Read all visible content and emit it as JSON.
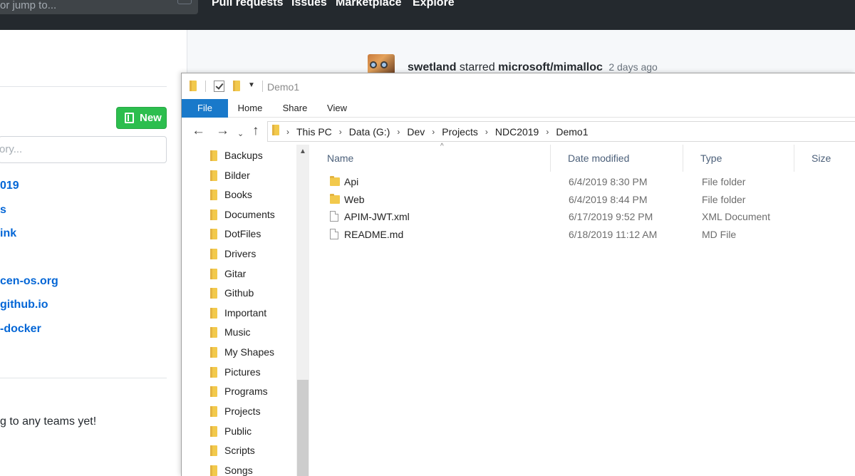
{
  "github": {
    "search_placeholder": "or jump to...",
    "search_shortcut": "/",
    "nav": [
      "Pull requests",
      "Issues",
      "Marketplace",
      "Explore"
    ],
    "new_button": "New",
    "filter_placeholder": "ory...",
    "repos": [
      "019",
      "s",
      "ink",
      "cen-os.org",
      "github.io",
      "-docker"
    ],
    "teams_text": "g to any teams yet!",
    "activity": {
      "user": "swetland",
      "action": "starred",
      "repo": "microsoft/mimalloc",
      "time": "2 days ago"
    },
    "colors": {
      "header_bg": "#24292e",
      "link": "#0366d6",
      "new_button": "#2cbe4e"
    }
  },
  "explorer": {
    "title": "Demo1",
    "quick_access_icons": [
      "folder-icon",
      "properties-check-icon",
      "new-folder-icon",
      "customize-dropdown-icon"
    ],
    "ribbon_tabs": [
      "File",
      "Home",
      "Share",
      "View"
    ],
    "nav_buttons": {
      "back": "←",
      "forward": "→",
      "recent": "⌄",
      "up": "↑"
    },
    "breadcrumb": [
      "This PC",
      "Data (G:)",
      "Dev",
      "Projects",
      "NDC2019",
      "Demo1"
    ],
    "nav_pane": [
      "Backups",
      "Bilder",
      "Books",
      "Documents",
      "DotFiles",
      "Drivers",
      "Gitar",
      "Github",
      "Important",
      "Music",
      "My Shapes",
      "Pictures",
      "Programs",
      "Projects",
      "Public",
      "Scripts",
      "Songs"
    ],
    "columns": [
      "Name",
      "Date modified",
      "Type",
      "Size"
    ],
    "files": [
      {
        "name": "Api",
        "date": "6/4/2019 8:30 PM",
        "type": "File folder",
        "icon": "folder-icon"
      },
      {
        "name": "Web",
        "date": "6/4/2019 8:44 PM",
        "type": "File folder",
        "icon": "folder-icon"
      },
      {
        "name": "APIM-JWT.xml",
        "date": "6/17/2019 9:52 PM",
        "type": "XML Document",
        "icon": "document-icon"
      },
      {
        "name": "README.md",
        "date": "6/18/2019 11:12 AM",
        "type": "MD File",
        "icon": "document-icon"
      }
    ],
    "colors": {
      "file_tab": "#1979ca",
      "folder": "#f2c94c",
      "header_text": "#4c607a"
    }
  }
}
